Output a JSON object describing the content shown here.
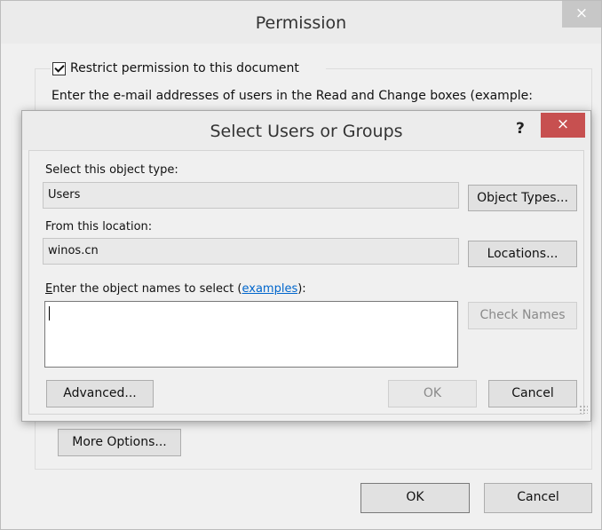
{
  "permission": {
    "title": "Permission",
    "close_glyph": "×",
    "restrict_label": "Restrict permission to this document",
    "restrict_checked": true,
    "instructions": "Enter the e-mail addresses of users in the Read and Change boxes (example:",
    "more_options_label": "More Options...",
    "ok_label": "OK",
    "cancel_label": "Cancel"
  },
  "select_users": {
    "title": "Select Users or Groups",
    "help_glyph": "?",
    "close_glyph": "×",
    "object_type_label": "Select this object type:",
    "object_type_value": "Users",
    "object_types_button": "Object Types...",
    "location_label": "From this location:",
    "location_value": "winos.cn",
    "locations_button": "Locations...",
    "names_label_prefix": "nter the object names to select (",
    "names_label_access_key": "E",
    "names_label_link": "examples",
    "names_label_suffix": "):",
    "names_value": "",
    "check_names_button": "Check Names",
    "advanced_button": "Advanced...",
    "ok_button": "OK",
    "cancel_button": "Cancel"
  },
  "icons": [
    "close-icon",
    "help-icon",
    "checkbox-checked-icon",
    "resize-grip-icon"
  ]
}
